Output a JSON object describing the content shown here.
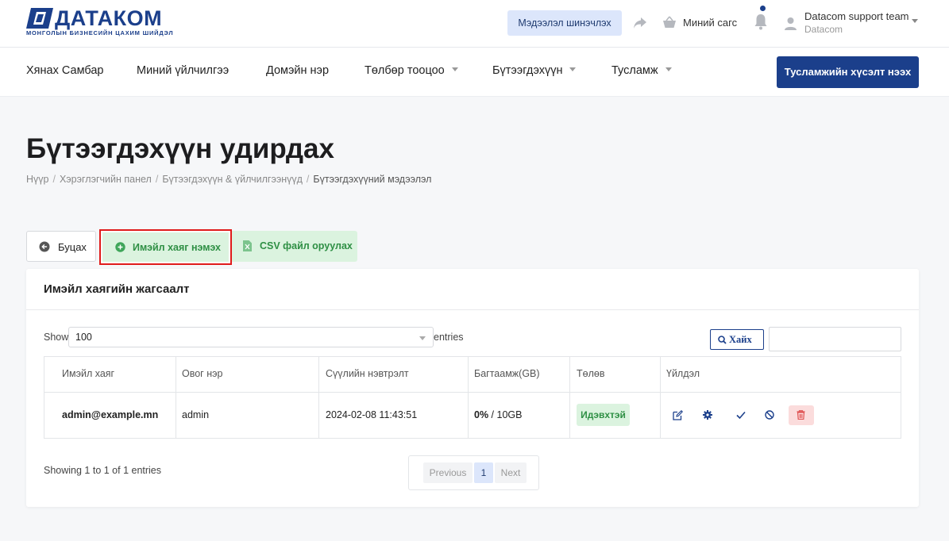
{
  "header": {
    "logo_text": "ДАТАКОМ",
    "logo_subtitle": "МОНГОЛЫН БИЗНЕСИЙН ЦАХИМ ШИЙДЭЛ",
    "update_button": "Мэдээлэл шинэчлэх",
    "cart_label": "Миний сагс",
    "user_name": "Datacom support team",
    "user_org": "Datacom"
  },
  "nav": {
    "items": [
      {
        "label": "Хянах Самбар"
      },
      {
        "label": "Миний үйлчилгээ"
      },
      {
        "label": "Домэйн нэр"
      },
      {
        "label": "Төлбөр тооцоо"
      },
      {
        "label": "Бүтээгдэхүүн"
      },
      {
        "label": "Тусламж"
      }
    ],
    "support_button": "Тусламжийн хүсэлт нээх"
  },
  "page": {
    "title": "Бүтээгдэхүүн удирдах",
    "breadcrumb": [
      "Нүүр",
      "Хэрэглэгчийн панел",
      "Бүтээгдэхүүн & үйлчилгээнүүд",
      "Бүтээгдэхүүний мэдээлэл"
    ]
  },
  "actions": {
    "back": "Буцах",
    "add_email": "Имэйл хаяг нэмэх",
    "import_csv": "CSV файл оруулах"
  },
  "card": {
    "title": "Имэйл хаягийн жагсаалт",
    "show_label": "Show",
    "page_size": "100",
    "entries_label": "entries",
    "search_button": "Хайх",
    "search_value": ""
  },
  "table": {
    "columns": [
      "Имэйл хаяг",
      "Овог нэр",
      "Сүүлийн нэвтрэлт",
      "Багтаамж(GB)",
      "Төлөв",
      "Үйлдэл"
    ],
    "rows": [
      {
        "email": "admin@example.mn",
        "name": "admin",
        "last_login": "2024-02-08 11:43:51",
        "usage_percent": "0%",
        "quota": " / 10GB",
        "status": "Идэвхтэй"
      }
    ]
  },
  "footer": {
    "info": "Showing 1 to 1 of 1 entries",
    "previous": "Previous",
    "current_page": "1",
    "next": "Next"
  },
  "colors": {
    "brand": "#1b3f8b",
    "success_bg": "#dbf3df",
    "success_text": "#2e8f44",
    "danger": "#e01b1b"
  }
}
